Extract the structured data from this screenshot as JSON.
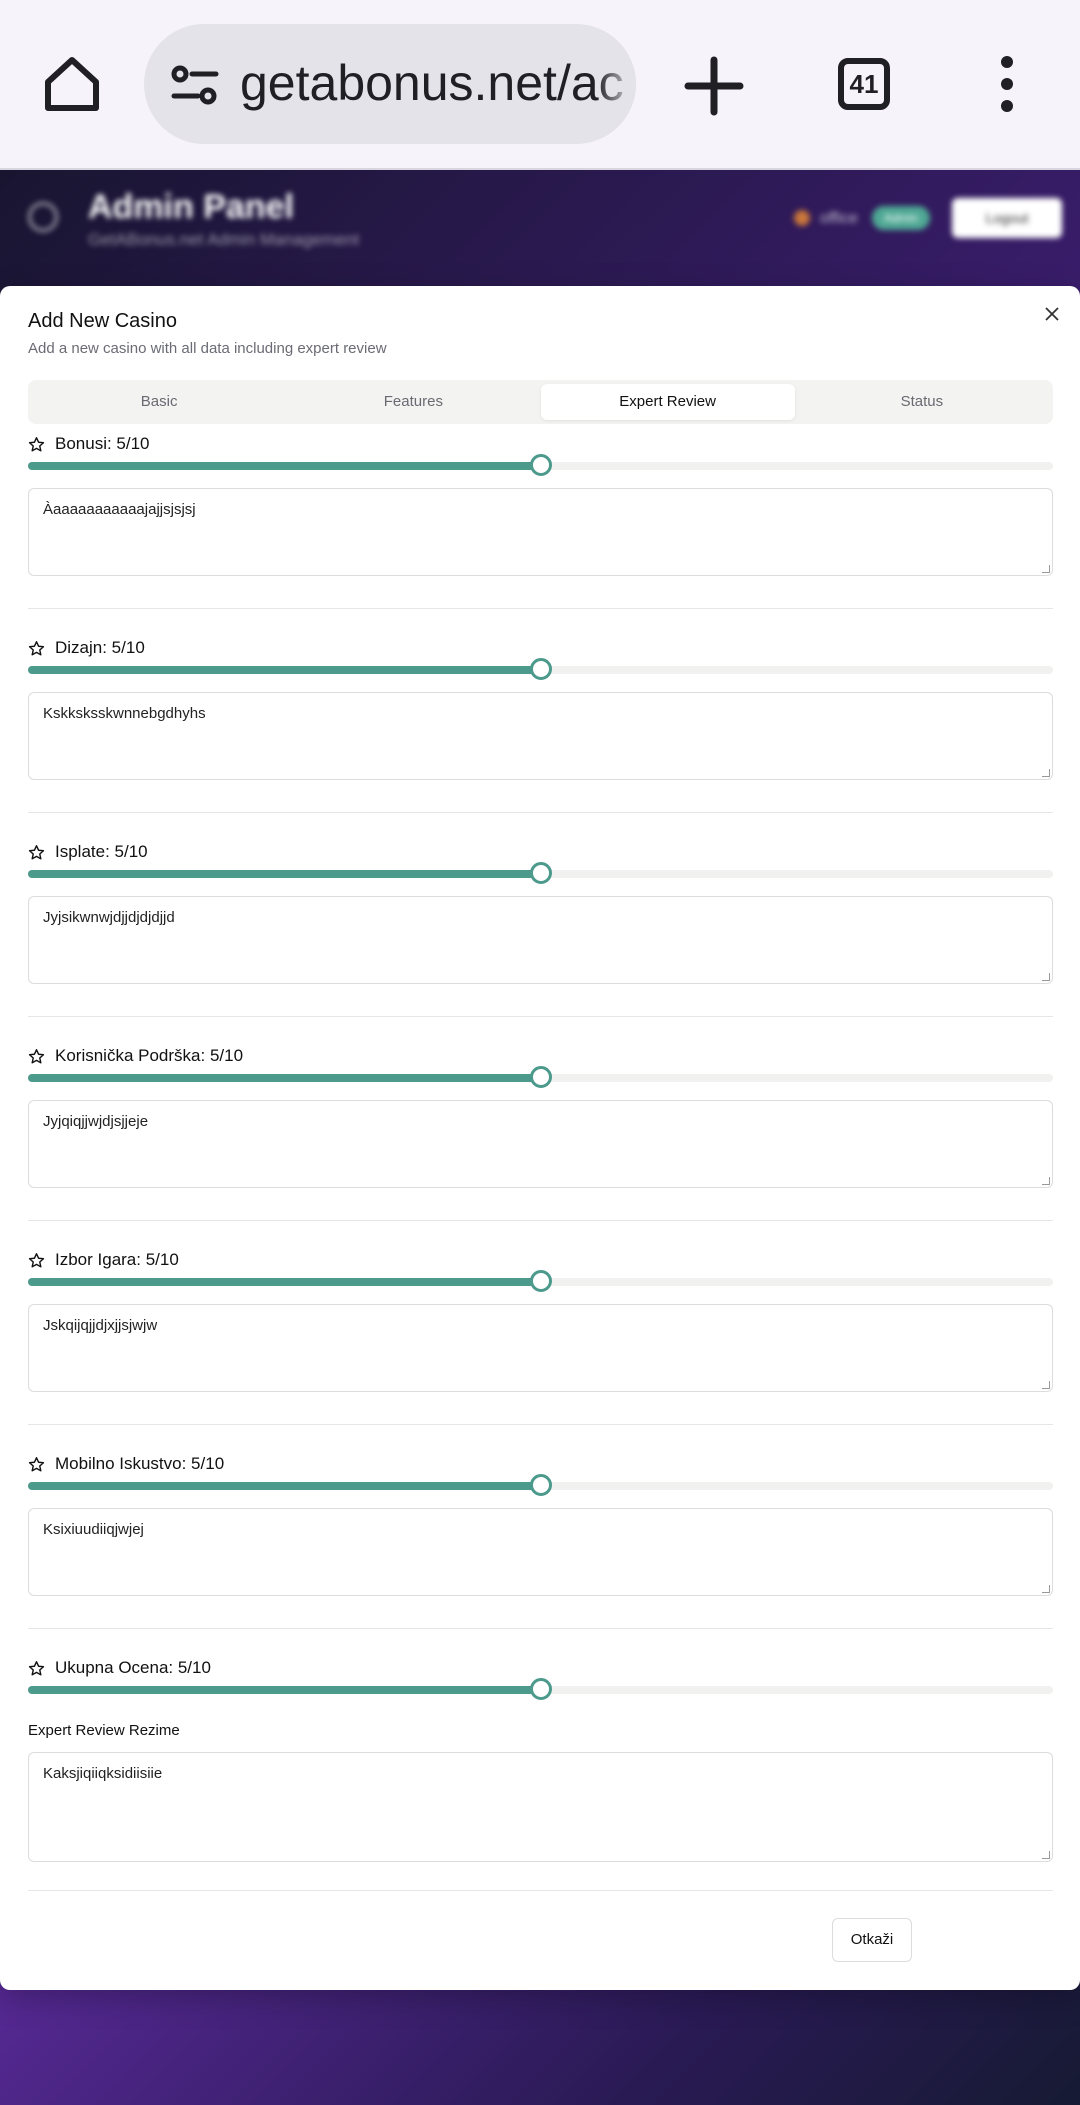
{
  "browser": {
    "url": "getabonus.net/ac",
    "tab_count": "41"
  },
  "admin_header": {
    "title": "Admin Panel",
    "subtitle": "GetABonus.net Admin Management",
    "user": "office",
    "badge": "Admin",
    "logout_label": "Logout"
  },
  "dialog": {
    "title": "Add New Casino",
    "description": "Add a new casino with all data including expert review",
    "tabs": [
      {
        "label": "Basic"
      },
      {
        "label": "Features"
      },
      {
        "label": "Expert Review"
      },
      {
        "label": "Status"
      }
    ],
    "active_tab": "Expert Review",
    "accent_color": "#4b9a8b",
    "ratings": [
      {
        "label": "Bonusi: 5/10",
        "value": 5,
        "max": 10,
        "comment": "Àaaaaaaaaaaajajjsjsjsj"
      },
      {
        "label": "Dizajn: 5/10",
        "value": 5,
        "max": 10,
        "comment": "Kskksksskwnnebgdhyhs"
      },
      {
        "label": "Isplate: 5/10",
        "value": 5,
        "max": 10,
        "comment": "Jyjsikwnwjdjjdjdjdjjd"
      },
      {
        "label": "Korisnička Podrška: 5/10",
        "value": 5,
        "max": 10,
        "comment": "Jyjqiqjjwjdjsjjeje"
      },
      {
        "label": "Izbor Igara: 5/10",
        "value": 5,
        "max": 10,
        "comment": "Jskqijqjjdjxjjsjwjw"
      },
      {
        "label": "Mobilno Iskustvo: 5/10",
        "value": 5,
        "max": 10,
        "comment": "Ksixiuudiiqjwjej"
      }
    ],
    "overall": {
      "label": "Ukupna Ocena: 5/10",
      "value": 5,
      "max": 10
    },
    "summary_label": "Expert Review Rezime",
    "summary_value": "Kaksjiqiiqksidiisiie",
    "cancel_label": "Otkaži"
  }
}
